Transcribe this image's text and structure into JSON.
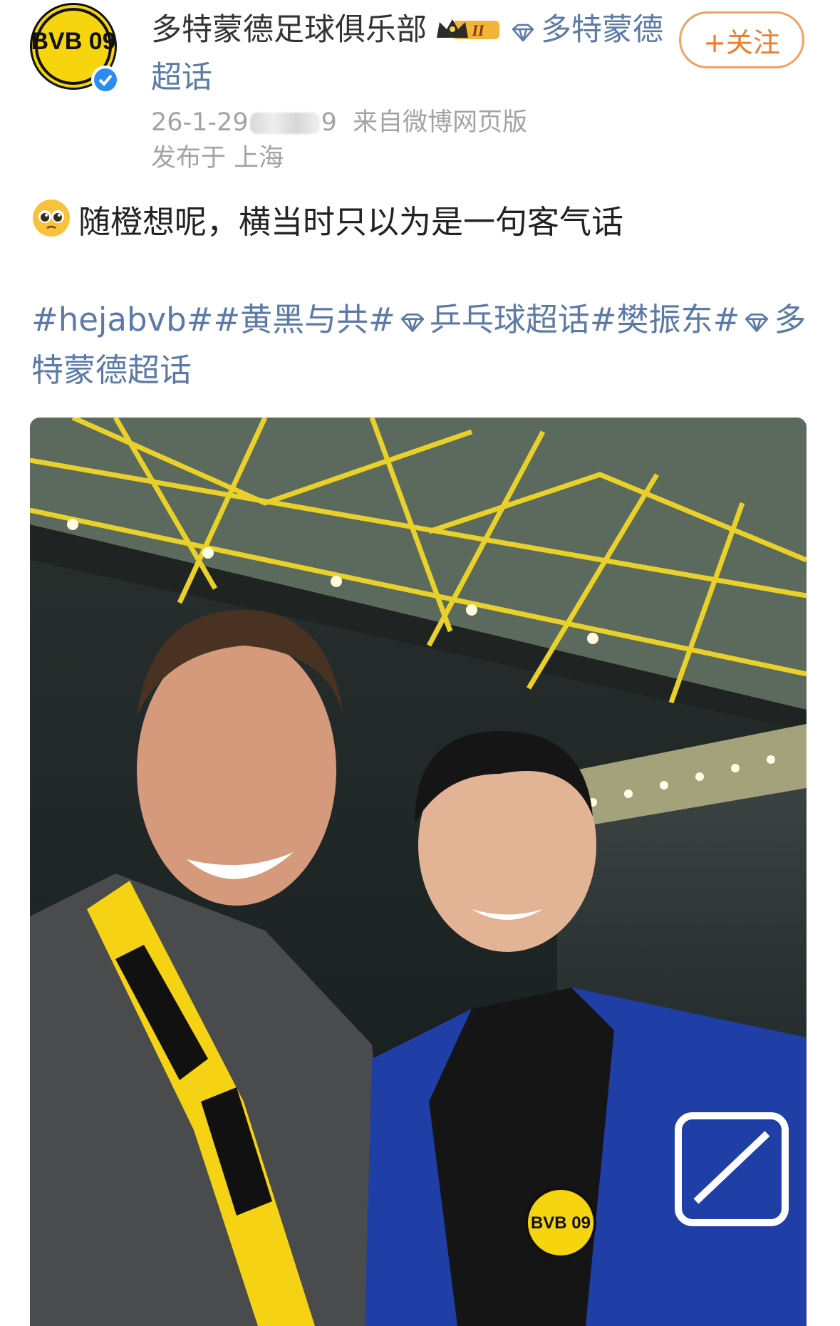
{
  "post": {
    "author": {
      "name": "多特蒙德足球俱乐部",
      "avatar_logo_text": "BVB 09",
      "verified_icon": "verified-badge-icon",
      "crown_badge_text": "II",
      "supertopic_prefix_icon": "diamond-icon",
      "supertopic": "多特蒙德超话"
    },
    "meta": {
      "date_visible": "26-1-29",
      "date_hidden_suffix": "9",
      "source": "来自微博网页版",
      "location": "发布于 上海"
    },
    "follow_button": {
      "label": "+关注",
      "plus": "+",
      "text": "关注"
    },
    "body_text": "随橙想呢，横当时只以为是一句客气话",
    "hashtags": [
      {
        "text": "#hejabvb#"
      },
      {
        "text": "#黄黑与共#"
      },
      {
        "text": "乒乓球超话",
        "icon": "diamond-icon"
      },
      {
        "text": "#樊振东#"
      },
      {
        "text": "多特蒙德超话",
        "icon": "diamond-icon"
      }
    ],
    "image": {
      "description_icon": "stadium-selfie-photo",
      "jacket_logo_text": "BVB 09"
    }
  },
  "colors": {
    "link": "#5b7aa8",
    "follow_accent": "#f07a2a",
    "meta_gray": "#a3a3a3",
    "brand_yellow": "#f6d50f"
  }
}
